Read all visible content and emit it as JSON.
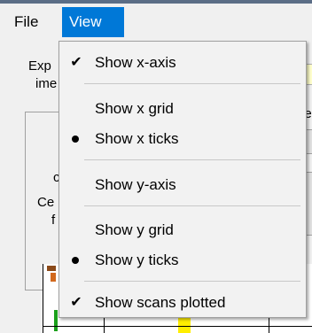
{
  "menubar": {
    "file_label": "File",
    "view_label": "View",
    "active_color": "#0078d7"
  },
  "background_window": {
    "text_exp": "Exp",
    "text_ime": "ime",
    "text_c": "c",
    "text_ce": "Ce",
    "text_f": "f",
    "text_le": "le"
  },
  "view_menu": {
    "items": [
      {
        "label": "Show x-axis",
        "state": "checked"
      },
      {
        "label": "Show x grid",
        "state": "unchecked"
      },
      {
        "label": "Show x ticks",
        "state": "radio"
      },
      {
        "label": "Show y-axis",
        "state": "unchecked"
      },
      {
        "label": "Show y grid",
        "state": "unchecked"
      },
      {
        "label": "Show y ticks",
        "state": "radio"
      },
      {
        "label": "Show scans plotted",
        "state": "checked"
      }
    ],
    "check_glyph": "✔"
  }
}
